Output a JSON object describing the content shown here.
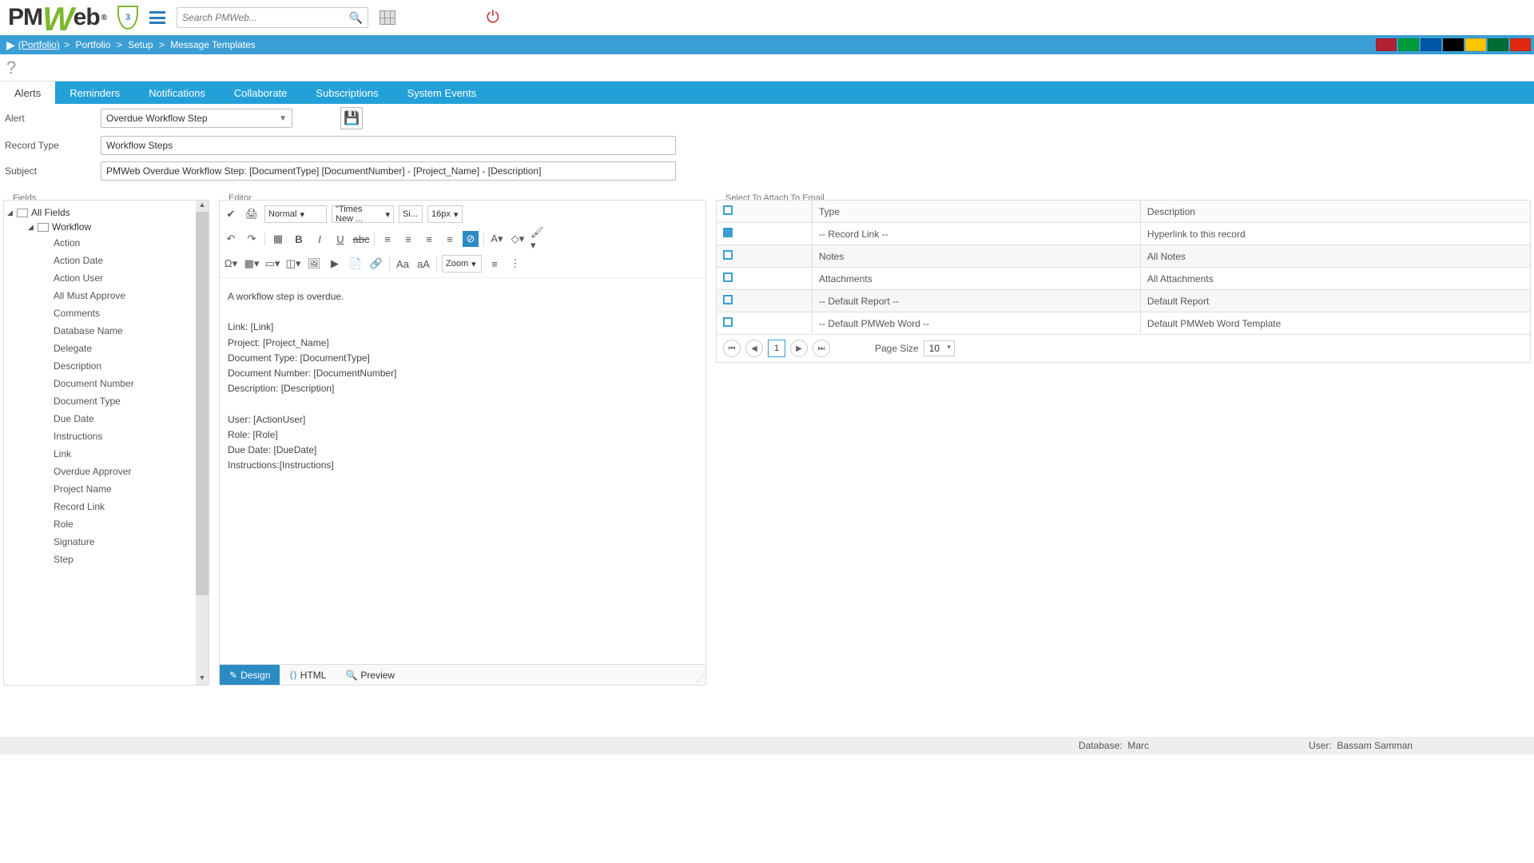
{
  "topbar": {
    "logo_pm": "PM",
    "logo_w": "W",
    "logo_eb": "eb",
    "shield_count": "3",
    "search_placeholder": "Search PMWeb..."
  },
  "breadcrumb": {
    "root": "(Portfolio)",
    "items": [
      "Portfolio",
      "Setup",
      "Message Templates"
    ]
  },
  "tabs": [
    "Alerts",
    "Reminders",
    "Notifications",
    "Collaborate",
    "Subscriptions",
    "System Events"
  ],
  "form": {
    "alert_label": "Alert",
    "alert_value": "Overdue Workflow Step",
    "record_type_label": "Record Type",
    "record_type_value": "Workflow Steps",
    "subject_label": "Subject",
    "subject_value": "PMWeb Overdue Workflow Step: [DocumentType] [DocumentNumber] - [Project_Name] - [Description]"
  },
  "fields_panel": {
    "title": "Fields",
    "root": "All Fields",
    "group": "Workflow",
    "items": [
      "Action",
      "Action Date",
      "Action User",
      "All Must Approve",
      "Comments",
      "Database Name",
      "Delegate",
      "Description",
      "Document Number",
      "Document Type",
      "Due Date",
      "Instructions",
      "Link",
      "Overdue Approver",
      "Project Name",
      "Record Link",
      "Role",
      "Signature",
      "Step"
    ]
  },
  "editor": {
    "title": "Editor",
    "para_style": "Normal",
    "font_family": "\"Times New ...",
    "font_size_small": "Si...",
    "font_size": "16px",
    "zoom": "Zoom",
    "body": "A workflow step is overdue.\n\nLink: [Link]\nProject: [Project_Name]\nDocument Type: [DocumentType]\nDocument Number: [DocumentNumber]\nDescription: [Description]\n\nUser: [ActionUser]\nRole: [Role]\nDue Date: [DueDate]\nInstructions:[Instructions]",
    "tabs": {
      "design": "Design",
      "html": "HTML",
      "preview": "Preview"
    }
  },
  "attach": {
    "title": "Select To Attach To Email",
    "headers": {
      "type": "Type",
      "description": "Description"
    },
    "rows": [
      {
        "checked": true,
        "type": "-- Record Link --",
        "desc": "Hyperlink to this record"
      },
      {
        "checked": false,
        "type": "Notes",
        "desc": "All Notes"
      },
      {
        "checked": false,
        "type": "Attachments",
        "desc": "All Attachments"
      },
      {
        "checked": false,
        "type": "-- Default Report --",
        "desc": "Default Report"
      },
      {
        "checked": false,
        "type": "-- Default PMWeb Word --",
        "desc": "Default PMWeb Word Template"
      }
    ],
    "page_size_label": "Page Size",
    "page_size_value": "10",
    "page_current": "1"
  },
  "footer": {
    "db_label": "Database:",
    "db_value": "Marc",
    "user_label": "User:",
    "user_value": "Bassam Samman"
  },
  "flag_colors": [
    "#b22234",
    "#009b3a",
    "#0055a4",
    "#000000",
    "#ffc400",
    "#006c35",
    "#de2910"
  ]
}
